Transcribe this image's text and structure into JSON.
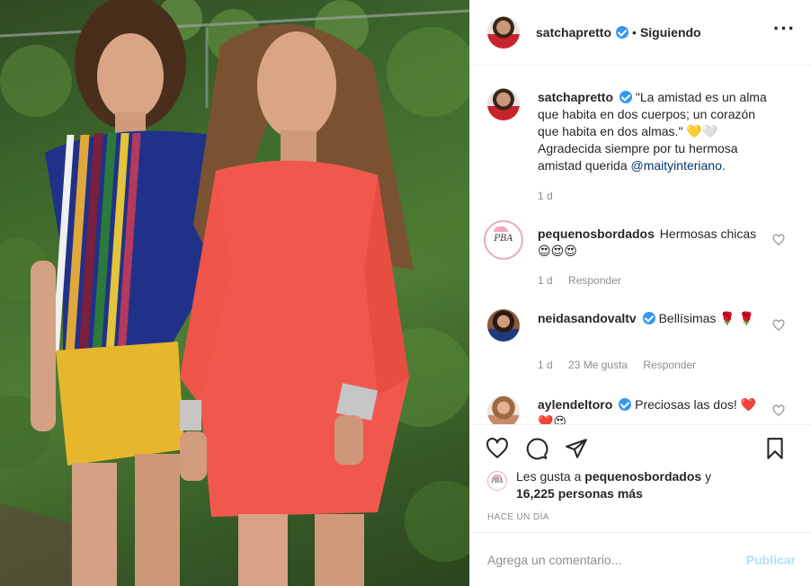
{
  "post_header": {
    "username": "satchapretto",
    "separator": "•",
    "follow_status": "Siguiendo",
    "more_icon": "more-options-icon"
  },
  "caption": {
    "username": "satchapretto",
    "text": "\"La amistad es un alma que habita en dos cuerpos; un corazón que habita en dos almas.\" 💛🤍 Agradecida siempre por tu hermosa amistad querida",
    "mention": "@maityinteriano",
    "trailing": ".",
    "time": "1 d"
  },
  "comments": [
    {
      "username": "pequenosbordados",
      "verified": false,
      "text": "Hermosas chicas😍😍😍",
      "time": "1 d",
      "likes": "",
      "reply": "Responder",
      "avatar_text": "PBA"
    },
    {
      "username": "neidasandovaltv",
      "verified": true,
      "text": "Bellísimas 🌹 🌹",
      "time": "1 d",
      "likes": "23 Me gusta",
      "reply": "Responder"
    },
    {
      "username": "aylendeltoro",
      "verified": true,
      "text": "Preciosas las dos! ❤️❤️😍",
      "time": "",
      "likes": "",
      "reply": ""
    }
  ],
  "actions": {
    "like_icon": "heart-icon",
    "comment_icon": "comment-icon",
    "share_icon": "send-icon",
    "save_icon": "bookmark-icon"
  },
  "likes_summary": {
    "prefix": "Les gusta a",
    "first_user": "pequenosbordados",
    "middle": "y",
    "others": "16,225 personas más",
    "avatar_text": "PBA"
  },
  "timestamp": "HACE UN DÍA",
  "comment_box": {
    "placeholder": "Agrega un comentario...",
    "publish_label": "Publicar"
  },
  "colors": {
    "verified": "#3897f0",
    "publish_disabled": "#b2dffc",
    "mention": "#00376b",
    "muted": "#8e8e8e"
  }
}
